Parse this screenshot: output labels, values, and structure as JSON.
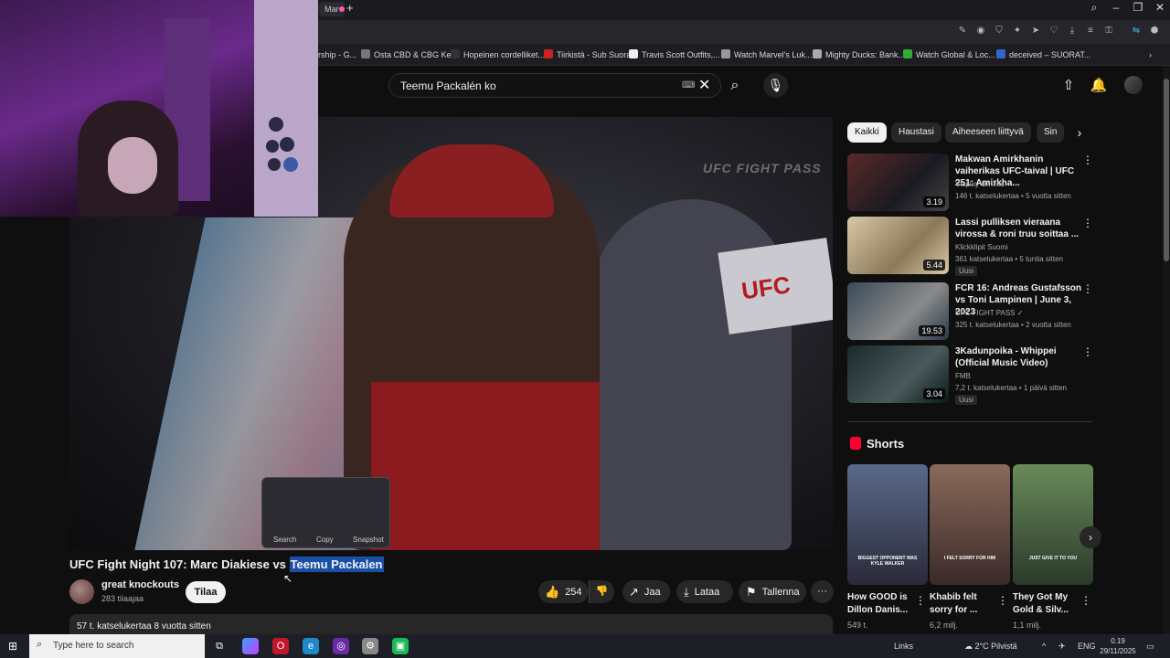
{
  "browser": {
    "active_tab_label": "Mar",
    "bookmarks": [
      {
        "label": "rship - G...",
        "color": "#444"
      },
      {
        "label": "Osta CBD & CBG Ke...",
        "color": "#777"
      },
      {
        "label": "Hopeinen cordelliket...",
        "color": "#333"
      },
      {
        "label": "Tiirkistä - Sub Suora",
        "color": "#c22"
      },
      {
        "label": "Travis Scott Outfits,...",
        "color": "#eee"
      },
      {
        "label": "Watch Marvel's Luk...",
        "color": "#999"
      },
      {
        "label": "Mighty Ducks: Bank...",
        "color": "#aaa"
      },
      {
        "label": "Watch Global & Loc...",
        "color": "#3a3"
      },
      {
        "label": "deceived – SUORAT...",
        "color": "#36c"
      }
    ]
  },
  "header": {
    "search_value": "Teemu Packalén ko",
    "keyboard_icon": "⌨",
    "clear_icon": "✕",
    "search_icon": "⌕",
    "mic_icon": "🎙",
    "upload_icon": "⇧",
    "bell_icon": "🔔"
  },
  "video": {
    "watermark": "UFC FIGHT PASS",
    "sign_text": "UFC",
    "popup": {
      "search": "Search",
      "copy": "Copy",
      "snapshot": "Snapshot"
    }
  },
  "info": {
    "title_prefix": "UFC Fight Night 107: Marc Diakiese vs ",
    "title_highlight": "Teemu Packalen",
    "channel": "great knockouts",
    "subscribers": "283 tilaajaa",
    "subscribe_label": "Tilaa",
    "likes": "254",
    "share_label": "Jaa",
    "download_label": "Lataa",
    "save_label": "Tallenna",
    "more_label": "···",
    "description": "57 t. katselukertaa  8 vuotta sitten"
  },
  "chips": [
    {
      "label": "Kaikki",
      "active": true
    },
    {
      "label": "Haustasi",
      "active": false
    },
    {
      "label": "Aiheeseen liittyvä",
      "active": false
    },
    {
      "label": "Sin",
      "active": false
    }
  ],
  "recommendations": [
    {
      "title": "Makwan Amirkhanin vaiherikas UFC-taival | UFC 251: Amirkha...",
      "channel": "Viaplay Urheilu",
      "meta": "146 t. katselukertaa • 5 vuotta sitten",
      "duration": "3.19",
      "badge": ""
    },
    {
      "title": "Lassi pulliksen vieraana virossa & roni truu soittaa ...",
      "channel": "Klickklipit Suomi",
      "meta": "361 katselukertaa • 5 tuntia sitten",
      "duration": "5.44",
      "badge": "Uusi"
    },
    {
      "title": "FCR 16: Andreas Gustafsson vs Toni Lampinen | June 3, 2023",
      "channel": "UFC FIGHT PASS ✓",
      "meta": "325 t. katselukertaa • 2 vuotta sitten",
      "duration": "19.53",
      "badge": ""
    },
    {
      "title": "3Kadunpoika - Whippei (Official Music Video)",
      "channel": "FMB",
      "meta": "7,2 t. katselukertaa • 1 päivä sitten",
      "duration": "3.04",
      "badge": "Uusi"
    }
  ],
  "shorts": {
    "heading": "Shorts",
    "items": [
      {
        "title": "How GOOD is Dillon Danis...",
        "views": "549 t.",
        "caption": "BIGGEST OPPONENT WAS KYLE WALKER"
      },
      {
        "title": "Khabib felt sorry for ...",
        "views": "6,2 milj.",
        "caption": "I FELT SORRY FOR HIM"
      },
      {
        "title": "They Got My Gold & Silv...",
        "views": "1,1 milj.",
        "caption": "JUST GIVE IT TO YOU"
      }
    ]
  },
  "taskbar": {
    "search_placeholder": "Type here to search",
    "links": "Links",
    "weather": "2°C  Pilvistä",
    "lang": "ENG",
    "time": "0.19",
    "date": "29/11/2025"
  },
  "colors": {
    "accent_red": "#ff0033",
    "highlight_blue": "#1a4fa8",
    "background": "#0f0f0f"
  }
}
